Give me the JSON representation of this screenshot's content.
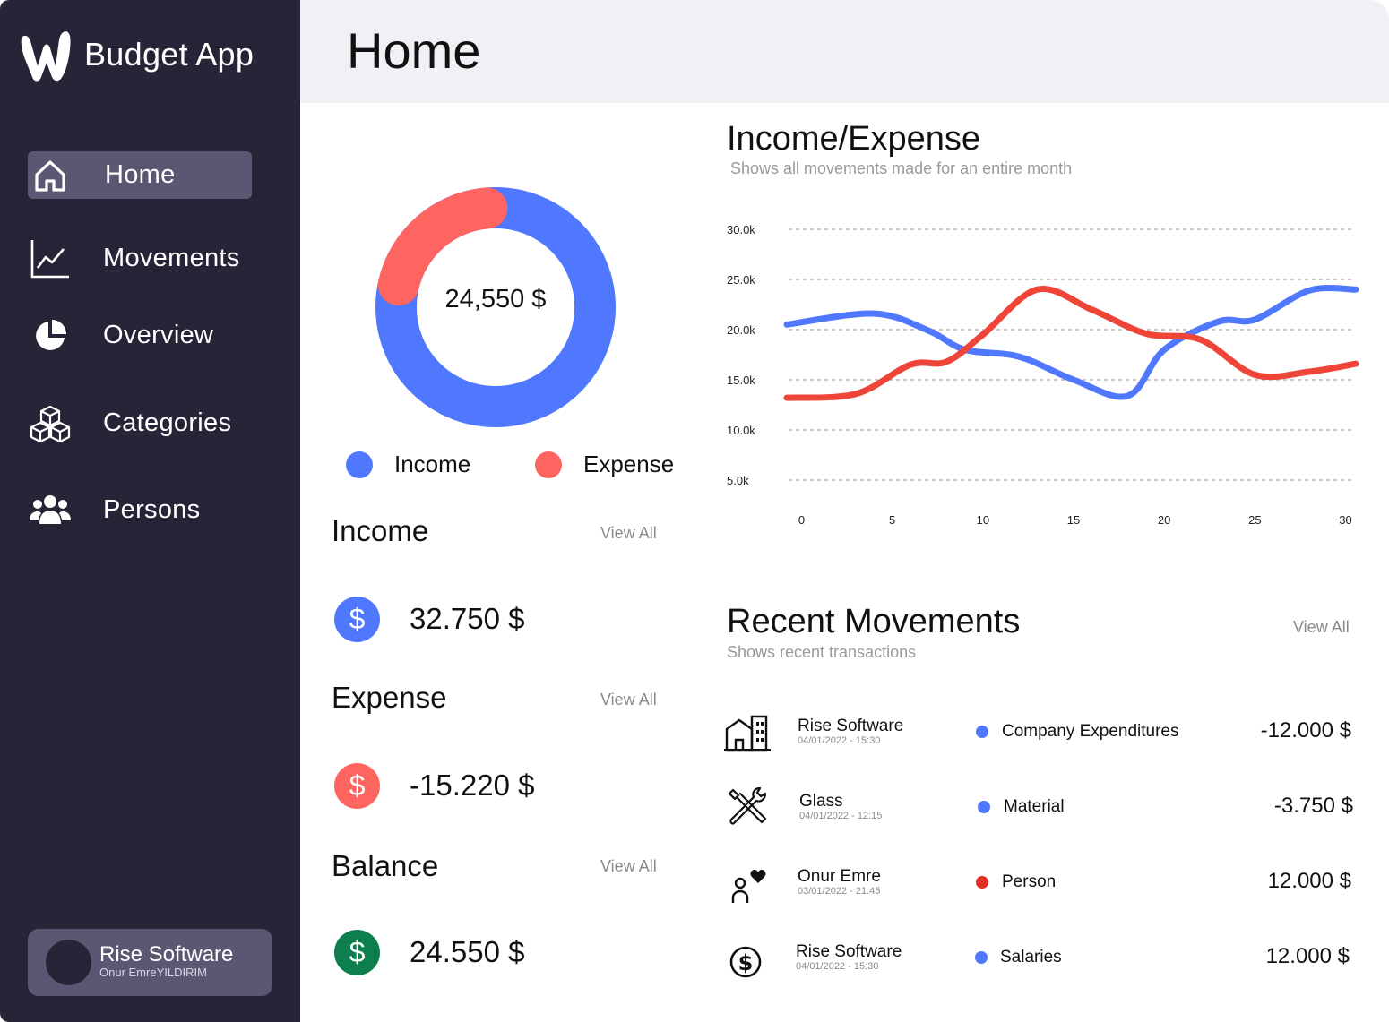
{
  "app": {
    "name": "Budget App",
    "logo_icon": "w-logo-icon"
  },
  "nav": [
    {
      "label": "Home",
      "icon": "home-icon",
      "active": true
    },
    {
      "label": "Movements",
      "icon": "chart-line-icon",
      "active": false
    },
    {
      "label": "Overview",
      "icon": "pie-icon",
      "active": false
    },
    {
      "label": "Categories",
      "icon": "cubes-icon",
      "active": false
    },
    {
      "label": "Persons",
      "icon": "users-icon",
      "active": false
    }
  ],
  "profile": {
    "name": "Rise Software",
    "subtitle": "Onur EmreYILDIRIM"
  },
  "header": {
    "title": "Home"
  },
  "donut": {
    "center_label": "24,550 $",
    "income_fraction": 0.8,
    "expense_fraction": 0.2,
    "legend": [
      {
        "label": "Income",
        "color": "#4f78fe"
      },
      {
        "label": "Expense",
        "color": "#fe6460"
      }
    ]
  },
  "summary": {
    "income": {
      "title": "Income",
      "view_all": "View All",
      "value": "32.750 $",
      "color": "#4f78fe",
      "symbol": "$"
    },
    "expense": {
      "title": "Expense",
      "view_all": "View All",
      "value": "-15.220 $",
      "color": "#fe6460",
      "symbol": "$"
    },
    "balance": {
      "title": "Balance",
      "view_all": "View All",
      "value": "24.550 $",
      "color": "#0d7f4f",
      "symbol": "$"
    }
  },
  "chart": {
    "title": "Income/Expense",
    "subtitle": "Shows all movements made for an entire month"
  },
  "chart_data": {
    "type": "line",
    "title": "Income/Expense",
    "subtitle": "Shows all movements made for an entire month",
    "x_ticks": [
      0,
      5,
      10,
      15,
      20,
      25,
      30
    ],
    "y_ticks": [
      "30.0k",
      "25.0k",
      "20.0k",
      "15.0k",
      "10.0k",
      "5.0k"
    ],
    "ylim": [
      5000,
      30000
    ],
    "xlim": [
      0,
      31
    ],
    "grid": true,
    "series": [
      {
        "color": "#4f78fe",
        "x": [
          -1,
          4,
          7,
          9,
          12,
          15,
          18,
          20,
          23,
          25,
          28,
          31
        ],
        "values": [
          20500,
          21600,
          19900,
          18000,
          17300,
          15000,
          13400,
          18000,
          20800,
          21000,
          23900,
          24000
        ]
      },
      {
        "color": "#ef4538",
        "x": [
          -1,
          3,
          6,
          8,
          10,
          13,
          16,
          19,
          22,
          25,
          28,
          31
        ],
        "values": [
          13200,
          13600,
          16500,
          16800,
          19500,
          24000,
          22000,
          19600,
          19000,
          15500,
          15800,
          16600
        ]
      }
    ]
  },
  "recent": {
    "title": "Recent Movements",
    "subtitle": "Shows recent transactions",
    "view_all": "View All",
    "items": [
      {
        "icon": "building-icon",
        "name": "Rise Software",
        "date": "04/01/2022 - 15:30",
        "category": "Company Expenditures",
        "category_color": "#4f78fe",
        "amount": "-12.000 $"
      },
      {
        "icon": "tools-icon",
        "name": "Glass",
        "date": "04/01/2022 - 12:15",
        "category": "Material",
        "category_color": "#4f78fe",
        "amount": "-3.750 $"
      },
      {
        "icon": "person-heart-icon",
        "name": "Onur Emre",
        "date": "03/01/2022 - 21:45",
        "category": "Person",
        "category_color": "#e62e23",
        "amount": "12.000 $"
      },
      {
        "icon": "dollar-circle-icon",
        "name": "Rise Software",
        "date": "04/01/2022 - 15:30",
        "category": "Salaries",
        "category_color": "#4f78fe",
        "amount": "12.000 $"
      }
    ]
  }
}
